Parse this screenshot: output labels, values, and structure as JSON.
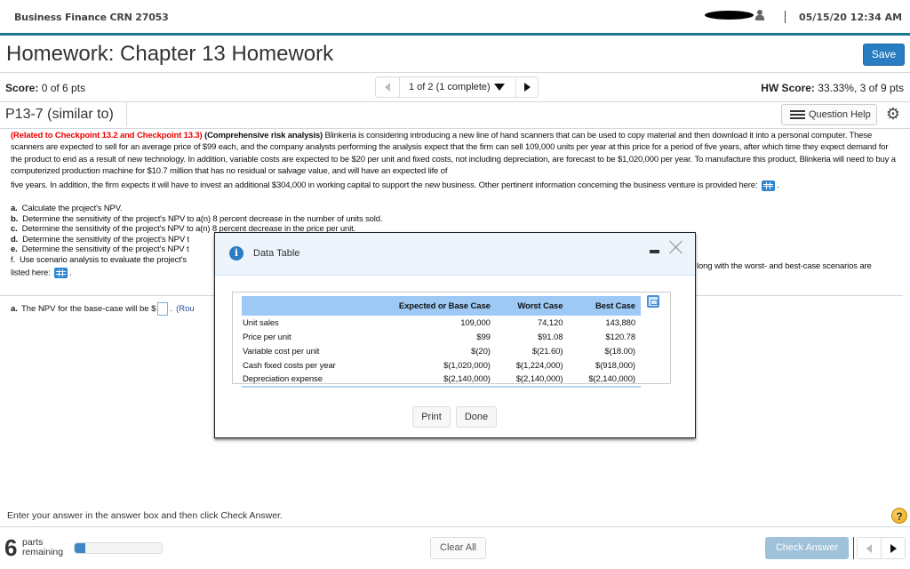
{
  "header": {
    "course": "Business Finance CRN 27053",
    "datetime": "05/15/20 12:34 AM"
  },
  "homework": {
    "title": "Homework: Chapter 13 Homework",
    "save_label": "Save",
    "score_label": "Score:",
    "score_value": "0 of 6 pts",
    "pager_text": "1 of 2 (1 complete)",
    "hw_score_label": "HW Score:",
    "hw_score_value": "33.33%, 3 of 9 pts"
  },
  "question": {
    "id": "P13-7 (similar to)",
    "help_label": "Question Help",
    "related": "(Related to Checkpoint 13.2 and Checkpoint 13.3)",
    "topic": "(Comprehensive risk analysis)",
    "body_1": "Blinkeria is considering introducing a new line of hand scanners that can be used to copy material and then download it into a personal computer.  These scanners are expected to sell for an average price of $99 each, and the company analysts performing the analysis expect that the firm can sell 109,000 units per year at this price for a period of five years, after which time they expect demand for the product to end as a result of new technology.  In addition, variable costs are expected to be $20 per unit and fixed costs, not including depreciation, are forecast to be $1,020,000 per year.  To manufacture this product, Blinkeria will need to buy a computerized production machine for $10.7 million that has no residual or salvage value, and will have an expected life of",
    "body_2": "five years.  In addition, the firm expects it will have to invest an additional $304,000 in working capital to support the new business.  Other pertinent information concerning the business venture is provided here:",
    "parts": [
      {
        "letter": "a.",
        "text": "Calculate the project's NPV."
      },
      {
        "letter": "b.",
        "text": "Determine the sensitivity of the project's NPV to a(n) 8 percent decrease in the number of units sold."
      },
      {
        "letter": "c.",
        "text": "Determine the sensitivity of the project's NPV to a(n) 8 percent decrease in the price per unit."
      },
      {
        "letter": "d.",
        "text": "Determine the sensitivity of the project's NPV t"
      },
      {
        "letter": "e.",
        "text": "Determine the sensitivity of the project's NPV t"
      },
      {
        "letter": "f.",
        "text": "Use scenario analysis to evaluate the project's"
      }
    ],
    "parts_tail": "long with the worst- and best-case scenarios are",
    "listed_here": "listed here:",
    "answer_letter": "a.",
    "answer_prompt": "The NPV for the base-case will be $",
    "answer_value": "",
    "round_hint": "(Rou"
  },
  "modal": {
    "title": "Data Table",
    "columns": [
      "",
      "Expected or Base Case",
      "Worst Case",
      "Best Case"
    ],
    "rows": [
      [
        "Unit sales",
        "109,000",
        "74,120",
        "143,880"
      ],
      [
        "Price per unit",
        "$99",
        "$91.08",
        "$120.78"
      ],
      [
        "Variable cost per unit",
        "$(20)",
        "$(21.60)",
        "$(18.00)"
      ],
      [
        "Cash fixed costs per year",
        "$(1,020,000)",
        "$(1,224,000)",
        "$(918,000)"
      ],
      [
        "Depreciation expense",
        "$(2,140,000)",
        "$(2,140,000)",
        "$(2,140,000)"
      ]
    ],
    "print_label": "Print",
    "done_label": "Done"
  },
  "footer": {
    "instruction": "Enter your answer in the answer box and then click Check Answer.",
    "parts_count": "6",
    "parts_label_1": "parts",
    "parts_label_2": "remaining",
    "progress_fraction": 0.12,
    "clear_label": "Clear All",
    "check_label": "Check Answer",
    "help_glyph": "?"
  },
  "colors": {
    "accent_bar": "#1a7a96",
    "save_button": "#2a7dc1",
    "related_text": "#ee0000",
    "table_header": "#9ec9f5",
    "check_button_disabled": "#9fc1da"
  }
}
